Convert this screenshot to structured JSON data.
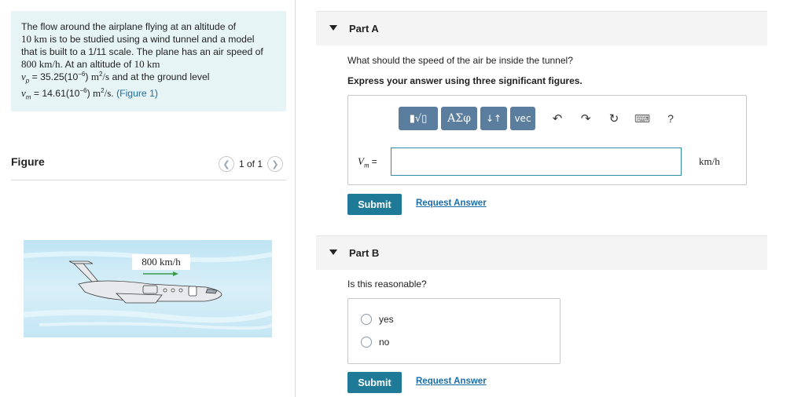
{
  "problem": {
    "line1": "The flow around the airplane flying at an altitude of",
    "line2_value": "10 km",
    "line2_rest": " is to be studied using a wind tunnel and a model",
    "line3": "that is built to a 1/11 scale. The plane has an air speed of",
    "line4_value": "800 km/h",
    "line4_mid": ". At an altitude of ",
    "line4_value2": "10 km",
    "nu_p_sym": "ν",
    "nu_p_sub": "p",
    "nu_p_value": " = 35.25(10",
    "nu_p_exp": "−6",
    "nu_p_close": ") ",
    "nu_p_unit": "m",
    "nu_p_unit_exp": "2",
    "nu_p_unit_rest": "/s",
    "nu_p_tail": " and at the ground level",
    "nu_m_sym": "ν",
    "nu_m_sub": "m",
    "nu_m_value": " = 14.61(10",
    "nu_m_exp": "−6",
    "nu_m_close": ") ",
    "nu_m_unit": "m",
    "nu_m_unit_exp": "2",
    "nu_m_unit_rest": "/s",
    "nu_m_tail": ". ",
    "figure_link": "(Figure 1)"
  },
  "figure": {
    "title": "Figure",
    "pager_text": "1 of 1",
    "prev_icon": "chevron-left-icon",
    "next_icon": "chevron-right-icon",
    "speed_label": "800 km/h"
  },
  "partA": {
    "label": "Part A",
    "question": "What should the speed of the air be inside the tunnel?",
    "instruction": "Express your answer using three significant figures.",
    "toolbar": {
      "templates": "▮√▯",
      "greek": "ΑΣφ",
      "arrows": "↓↑",
      "vec": "vec",
      "undo": "↶",
      "redo": "↷",
      "reset": "↻",
      "keyboard": "⌨",
      "help": "?"
    },
    "var_sym": "V",
    "var_sub": "m",
    "equals": " =",
    "input_value": "",
    "unit": "km/h",
    "submit": "Submit",
    "request": "Request Answer"
  },
  "partB": {
    "label": "Part B",
    "question": "Is this reasonable?",
    "options": [
      "yes",
      "no"
    ],
    "submit": "Submit",
    "request": "Request Answer"
  },
  "colors": {
    "accent": "#1f7a97",
    "toolbar": "#5b7e9e",
    "problem_bg": "#e6f4f6",
    "link": "#1a6ea8"
  }
}
